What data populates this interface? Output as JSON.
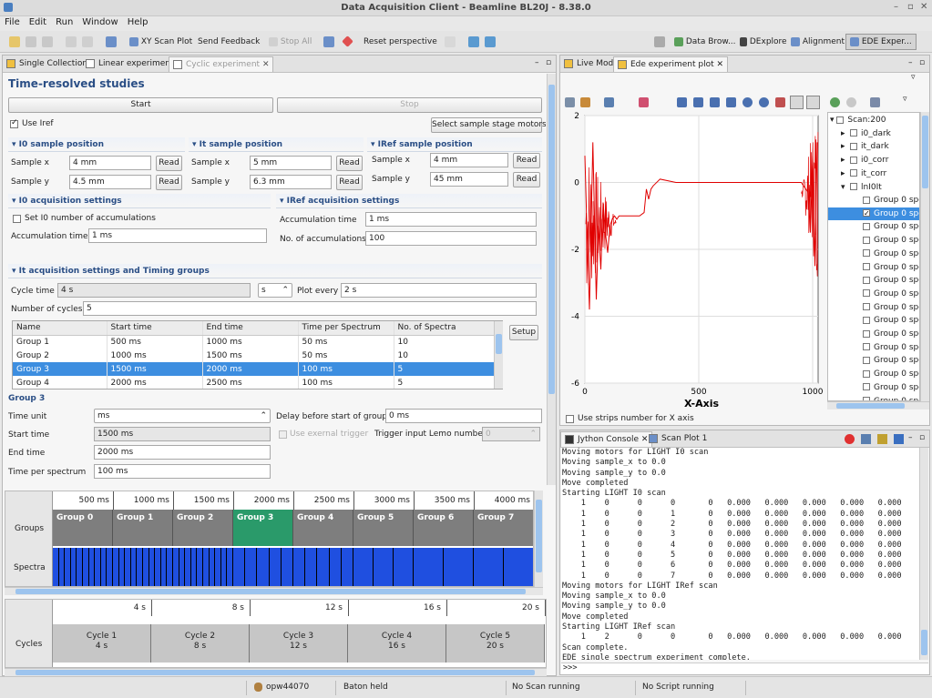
{
  "window": {
    "title": "Data Acquisition Client - Beamline BL20J - 8.38.0"
  },
  "menu": [
    "File",
    "Edit",
    "Run",
    "Window",
    "Help"
  ],
  "toolbar": {
    "xy_scan_plot": "XY Scan Plot",
    "send_feedback": "Send Feedback",
    "stop_all": "Stop All",
    "reset_perspective": "Reset perspective",
    "perspectives": [
      "Data Brow...",
      "DExplore",
      "Alignment",
      "EDE Exper..."
    ]
  },
  "left_tabs": [
    "Single Collection",
    "Linear experiment",
    "Cyclic experiment"
  ],
  "form": {
    "title": "Time-resolved studies",
    "start": "Start",
    "stop": "Stop",
    "use_iref": "Use Iref",
    "select_motors": "Select sample stage motors",
    "i0_pos": {
      "title": "I0 sample position",
      "x_label": "Sample x",
      "x": "4 mm",
      "y_label": "Sample y",
      "y": "4.5 mm"
    },
    "it_pos": {
      "title": "It sample position",
      "x_label": "Sample x",
      "x": "5 mm",
      "y_label": "Sample y",
      "y": "6.3 mm"
    },
    "iref_pos": {
      "title": "IRef sample position",
      "x_label": "Sample x",
      "x": "4 mm",
      "y_label": "Sample y",
      "y": "45 mm"
    },
    "read": "Read",
    "i0_acq": {
      "title": "I0 acquisition settings",
      "set_num": "Set I0 number of accumulations",
      "acc_time_label": "Accumulation time",
      "acc_time": "1 ms"
    },
    "iref_acq": {
      "title": "IRef acquisition settings",
      "acc_time_label": "Accumulation time",
      "acc_time": "1 ms",
      "num_label": "No. of accumulations",
      "num": "100"
    },
    "it_acq": {
      "title": "It acquisition settings and Timing groups",
      "cycle_time_label": "Cycle time",
      "cycle_time": "4 s",
      "unit": "s",
      "plot_every_label": "Plot every",
      "plot_every": "2 s",
      "num_cycles_label": "Number of cycles",
      "num_cycles": "5"
    },
    "setup": "Setup",
    "table": {
      "headers": [
        "Name",
        "Start time",
        "End time",
        "Time per Spectrum",
        "No. of Spectra"
      ],
      "rows": [
        [
          "Group 1",
          "500 ms",
          "1000 ms",
          "50 ms",
          "10"
        ],
        [
          "Group 2",
          "1000 ms",
          "1500 ms",
          "50 ms",
          "10"
        ],
        [
          "Group 3",
          "1500 ms",
          "2000 ms",
          "100 ms",
          "5"
        ],
        [
          "Group 4",
          "2000 ms",
          "2500 ms",
          "100 ms",
          "5"
        ]
      ]
    },
    "group": {
      "title": "Group 3",
      "time_unit_label": "Time unit",
      "time_unit": "ms",
      "delay_label": "Delay before start of group",
      "delay": "0 ms",
      "start_label": "Start time",
      "start": "1500 ms",
      "ext_trigger": "Use exernal trigger",
      "lemo_label": "Trigger input Lemo number",
      "lemo": "0",
      "end_label": "End time",
      "end": "2000 ms",
      "tps_label": "Time per spectrum",
      "tps": "100 ms"
    }
  },
  "timeline": {
    "ticks": [
      "500 ms",
      "1000 ms",
      "1500 ms",
      "2000 ms",
      "2500 ms",
      "3000 ms",
      "3500 ms",
      "4000 ms"
    ],
    "row_groups": "Groups",
    "row_spectra": "Spectra",
    "groups": [
      "Group 0",
      "Group 1",
      "Group 2",
      "Group 3",
      "Group 4",
      "Group 5",
      "Group 6",
      "Group 7"
    ],
    "highlight_index": 3,
    "spectra_counts": [
      10,
      10,
      10,
      5,
      5,
      3,
      2,
      2
    ]
  },
  "cycles": {
    "ticks": [
      "4 s",
      "8 s",
      "12 s",
      "16 s",
      "20 s"
    ],
    "row_label": "Cycles",
    "items": [
      {
        "name": "Cycle 1",
        "time": "4 s"
      },
      {
        "name": "Cycle 2",
        "time": "8 s"
      },
      {
        "name": "Cycle 3",
        "time": "12 s"
      },
      {
        "name": "Cycle 4",
        "time": "16 s"
      },
      {
        "name": "Cycle 5",
        "time": "20 s"
      }
    ]
  },
  "plot_tabs": [
    "Live Mode",
    "Ede experiment plot"
  ],
  "chart_data": {
    "type": "line",
    "xlabel": "X-Axis",
    "xlim": [
      0,
      1024
    ],
    "ylim": [
      -6,
      2
    ],
    "xticks": [
      "0",
      "500",
      "1000"
    ],
    "yticks": [
      "2",
      "0",
      "-2",
      "-4",
      "-6"
    ],
    "series_color": "#e00000",
    "series": [
      {
        "x": [
          0,
          8,
          20,
          35,
          50,
          60,
          70,
          80,
          90,
          100,
          110,
          120,
          130,
          140,
          150,
          160,
          170,
          180,
          200,
          240,
          260,
          270,
          280,
          290,
          300,
          330,
          400,
          500,
          600,
          700,
          800,
          900,
          950,
          980,
          990,
          1000,
          1010,
          1020
        ],
        "y": [
          0.8,
          -1.2,
          -3.8,
          1.2,
          -3.5,
          -1.3,
          -2.6,
          -0.6,
          -1.5,
          -2.1,
          -1.3,
          -1.1,
          -1.0,
          -1.1,
          -1.0,
          -1.0,
          -1.0,
          -1.0,
          -1.0,
          -1.0,
          -0.9,
          -0.2,
          -0.5,
          -0.2,
          -0.1,
          0.1,
          0.0,
          0.0,
          0.0,
          0.0,
          0.0,
          0.0,
          0.0,
          -0.3,
          -1.5,
          0.8,
          -2.5,
          1.2
        ]
      }
    ]
  },
  "plot_check": "Use strips number for X axis",
  "scan_tree": {
    "root": "Scan:200",
    "items": [
      "i0_dark",
      "it_dark",
      "i0_corr",
      "it_corr",
      "lnI0It"
    ],
    "group_label": "Group 0 spe",
    "group_count": 22,
    "selected_index": 1
  },
  "console_tabs": [
    "Jython Console",
    "Scan Plot 1"
  ],
  "console": {
    "prompt": ">>>",
    "lines": [
      "Moving motors for LIGHT I0 scan",
      "Moving sample_x to 0.0",
      "Moving sample_y to 0.0",
      "Move completed",
      "Starting LIGHT I0 scan",
      "    1    0      0      0       0   0.000   0.000   0.000   0.000   0.000",
      "    1    0      0      1       0   0.000   0.000   0.000   0.000   0.000",
      "    1    0      0      2       0   0.000   0.000   0.000   0.000   0.000",
      "    1    0      0      3       0   0.000   0.000   0.000   0.000   0.000",
      "    1    0      0      4       0   0.000   0.000   0.000   0.000   0.000",
      "    1    0      0      5       0   0.000   0.000   0.000   0.000   0.000",
      "    1    0      0      6       0   0.000   0.000   0.000   0.000   0.000",
      "    1    0      0      7       0   0.000   0.000   0.000   0.000   0.000",
      "Moving motors for LIGHT IRef scan",
      "Moving sample_x to 0.0",
      "Moving sample_y to 0.0",
      "Move completed",
      "Starting LIGHT IRef scan",
      "    1    2      0      0       0   0.000   0.000   0.000   0.000   0.000",
      "Scan complete.",
      "EDE single spectrum experiment complete."
    ]
  },
  "status": {
    "user": "opw44070",
    "baton": "Baton held",
    "scan": "No Scan running",
    "script": "No Script running"
  }
}
